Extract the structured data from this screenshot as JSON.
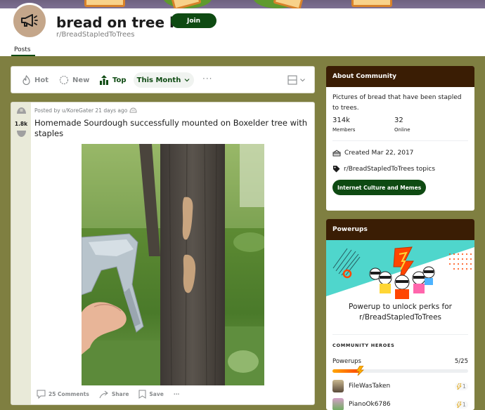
{
  "header": {
    "title": "bread on tree lol",
    "subreddit": "r/BreadStapledToTrees",
    "join_label": "Join",
    "tabs": [
      {
        "label": "Posts",
        "active": true
      }
    ]
  },
  "sortbar": {
    "items": [
      {
        "label": "Hot",
        "icon": "flame-icon",
        "active": false
      },
      {
        "label": "New",
        "icon": "sparkle-icon",
        "active": false
      },
      {
        "label": "Top",
        "icon": "top-chart-icon",
        "active": true
      }
    ],
    "time_filter": "This Month",
    "more_label": "···"
  },
  "post": {
    "vote_count": "1.8k",
    "meta": "Posted by u/KoreGater 21 days ago",
    "title": "Homemade Sourdough successfully mounted on Boxelder tree with staples",
    "image_alt": "Hand holding a staple gun next to a tree trunk with two pieces of bread stapled to it",
    "actions": {
      "comments": "25 Comments",
      "share": "Share",
      "save": "Save",
      "more": "···"
    }
  },
  "about": {
    "heading": "About Community",
    "description": "Pictures of bread that have been stapled to trees.",
    "members_count": "314k",
    "members_label": "Members",
    "online_count": "32",
    "online_label": "Online",
    "created": "Created Mar 22, 2017",
    "topics_label": "r/BreadStapledToTrees topics",
    "topic": "Internet Culture and Memes"
  },
  "powerups": {
    "heading": "Powerups",
    "promo": "Powerup to unlock perks for r/BreadStapledToTrees",
    "heroes_label": "COMMUNITY HEROES",
    "progress_label": "Powerups",
    "progress_text": "5/25",
    "progress_fraction": 0.2,
    "heroes": [
      {
        "name": "FileWasTaken",
        "count": "1"
      },
      {
        "name": "PianoOk6786",
        "count": "1"
      }
    ]
  },
  "colors": {
    "accent": "#0e4a12",
    "background": "#7f7f41",
    "card_header": "#3a1d04"
  }
}
